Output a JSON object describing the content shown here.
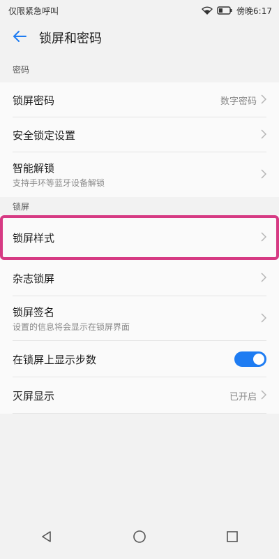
{
  "status_bar": {
    "left_text": "仅限紧急呼叫",
    "time": "傍晚6:17",
    "icons": [
      "wifi-icon",
      "battery-icon"
    ]
  },
  "app_bar": {
    "title": "锁屏和密码",
    "back_icon": "arrow-left-icon"
  },
  "sections": {
    "password": {
      "header": "密码",
      "items": [
        {
          "title": "锁屏密码",
          "value": "数字密码"
        },
        {
          "title": "安全锁定设置"
        },
        {
          "title": "智能解锁",
          "subtitle": "支持手环等蓝牙设备解锁"
        }
      ]
    },
    "lock_screen": {
      "header": "锁屏",
      "items": [
        {
          "title": "锁屏样式"
        },
        {
          "title": "杂志锁屏"
        },
        {
          "title": "锁屏签名",
          "subtitle": "设置的信息将会显示在锁屏界面"
        },
        {
          "title": "在锁屏上显示步数",
          "toggle": true
        },
        {
          "title": "灭屏显示",
          "value": "已开启"
        }
      ]
    }
  },
  "colors": {
    "accent": "#1e7cf2",
    "highlight": "#d63a83",
    "background": "#f2f2f2"
  },
  "nav_bar": {
    "icons": [
      "back-triangle-icon",
      "home-circle-icon",
      "recents-square-icon"
    ]
  }
}
